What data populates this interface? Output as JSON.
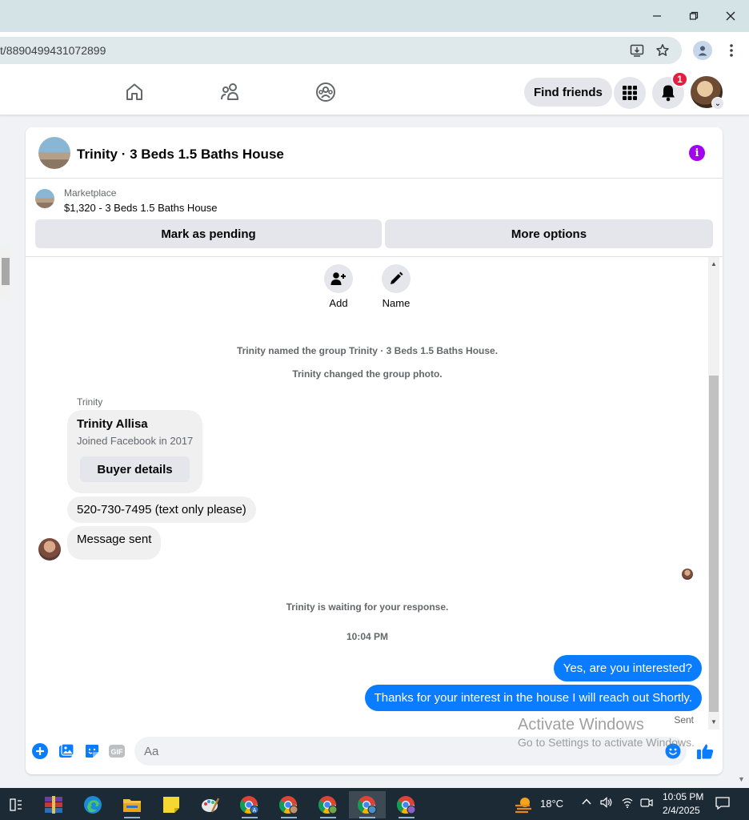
{
  "browser": {
    "url": "t/8890499431072899",
    "window_controls": [
      "minimize-icon",
      "restore-icon",
      "close-icon"
    ]
  },
  "header": {
    "nav_icons": [
      "home-icon",
      "friends-icon",
      "groups-icon"
    ],
    "find_friends_label": "Find friends",
    "notification_count": "1"
  },
  "chat": {
    "title": "Trinity · 3 Beds 1.5 Baths House",
    "marketplace_label": "Marketplace",
    "listing": "$1,320 - 3 Beds 1.5 Baths House",
    "mark_pending_label": "Mark as pending",
    "more_options_label": "More options",
    "actions": {
      "add_label": "Add",
      "name_label": "Name"
    },
    "system_messages": {
      "named": "Trinity named the group Trinity · 3 Beds 1.5 Baths House.",
      "photo": "Trinity changed the group photo.",
      "waiting": "Trinity is waiting for your response.",
      "time": "10:04 PM"
    },
    "incoming": {
      "sender": "Trinity",
      "card_name": "Trinity Allisa",
      "card_sub": "Joined Facebook in 2017",
      "card_button": "Buyer details",
      "phone_msg": "520-730-7495 (text only please)",
      "sent_msg": "Message sent"
    },
    "outgoing": {
      "msg1": "Yes, are you interested?",
      "msg2": "Thanks for your interest in the house I will reach out Shortly.",
      "status": "Sent"
    },
    "composer": {
      "placeholder": "Aa"
    }
  },
  "watermark": {
    "line1": "Activate Windows",
    "line2": "Go to Settings to activate Windows."
  },
  "taskbar": {
    "temperature": "18°C",
    "time": "10:05 PM",
    "date": "2/4/2025"
  },
  "colors": {
    "messenger_blue": "#0a7cff",
    "info_purple": "#a200f0",
    "badge_red": "#e41e3f"
  }
}
